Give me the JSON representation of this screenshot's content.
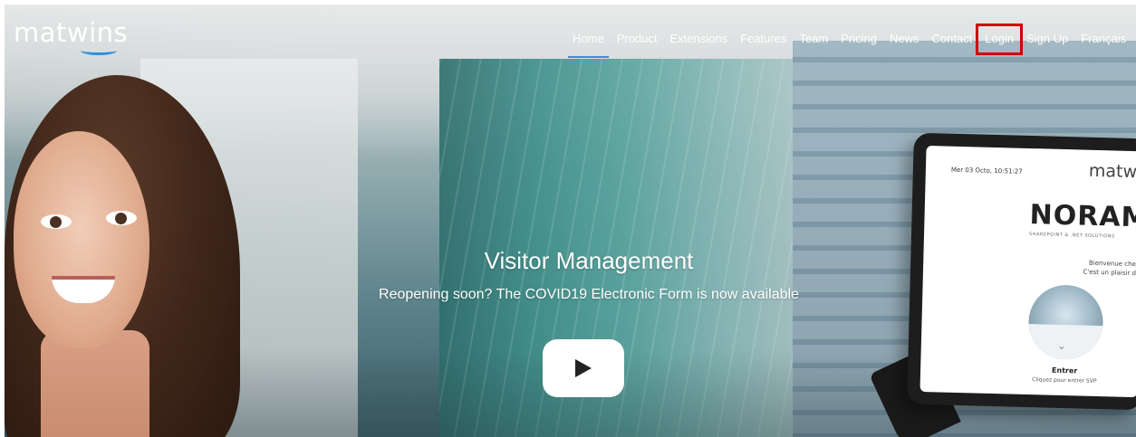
{
  "brand": {
    "logo_text": "matwins"
  },
  "nav": {
    "items": [
      {
        "label": "Home",
        "active": true
      },
      {
        "label": "Product"
      },
      {
        "label": "Extensions"
      },
      {
        "label": "Features"
      },
      {
        "label": "Team"
      },
      {
        "label": "Pricing"
      },
      {
        "label": "News"
      },
      {
        "label": "Contact"
      },
      {
        "label": "Login",
        "highlighted": true
      },
      {
        "label": "Sign Up"
      },
      {
        "label": "Français"
      }
    ],
    "active_underline_color": "#3b8fd8",
    "highlight_color": "#d10000"
  },
  "hero": {
    "title": "Visitor Management",
    "subtitle": "Reopening soon? The COVID19 Electronic Form is now available",
    "play_icon": "play-icon"
  },
  "tablet": {
    "date": "Mer 03 Octo, 10:51:27",
    "logo": "matwi",
    "brand": "NORAM",
    "brand_sub": "SHAREPOINT & .NET SOLUTIONS",
    "welcome_line1": "Bienvenue chez No",
    "welcome_line2": "C'est un plaisir de vo",
    "enter": "Entrer",
    "hint": "Cliquez pour entrer SVP"
  },
  "colors": {
    "logo_swoosh": "#2b8ee0"
  }
}
